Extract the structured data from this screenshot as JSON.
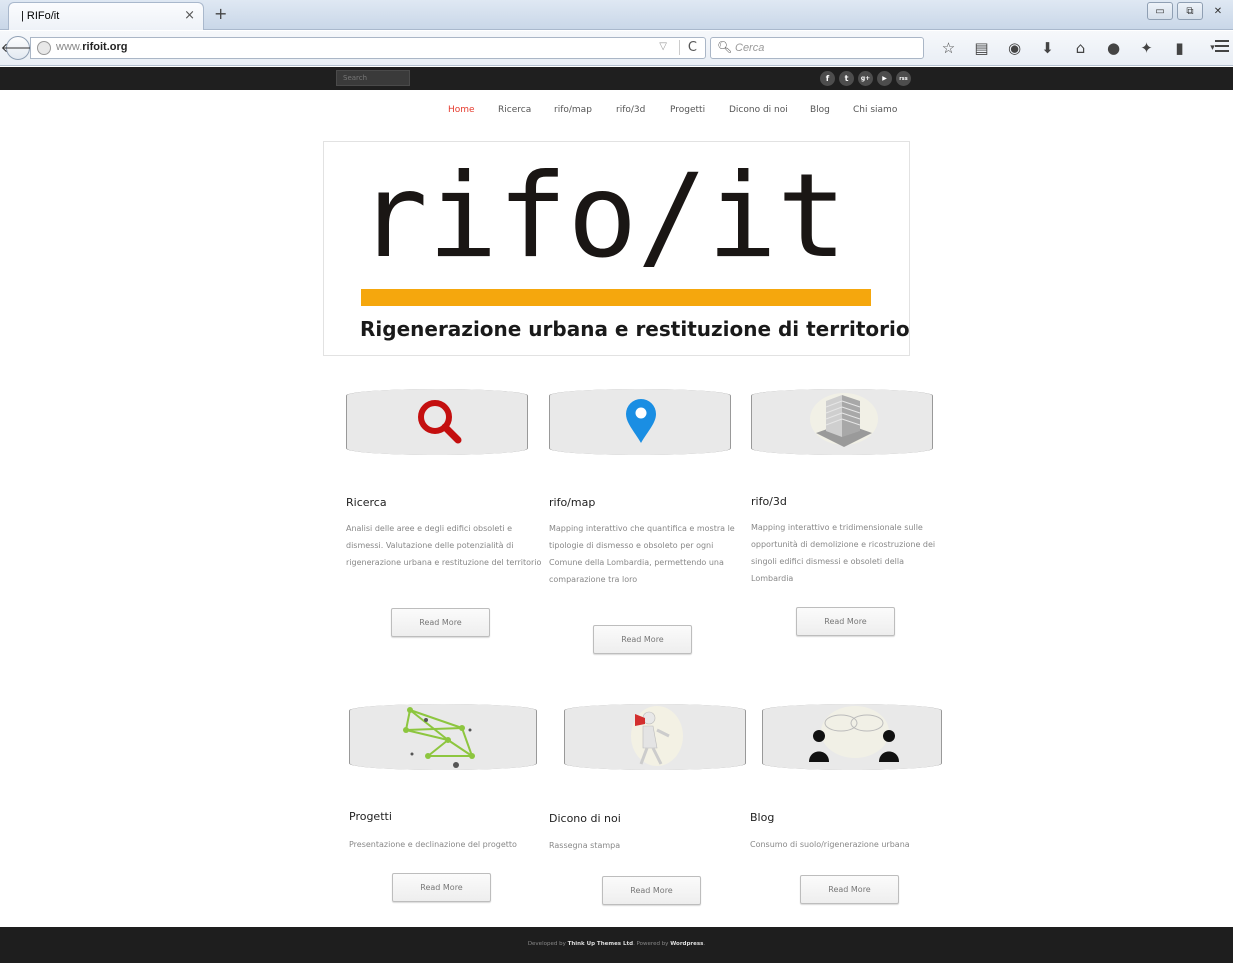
{
  "browser": {
    "tab_title": "| RIFo/it",
    "tab_close": "×",
    "new_tab": "+",
    "url_prefix": "www.",
    "url_domain": "rifoit.org",
    "search_placeholder": "Cerca",
    "toolbar_icons": [
      "star-icon",
      "reading-list-icon",
      "pocket-icon",
      "download-icon",
      "home-icon",
      "chat-icon",
      "extension-icon",
      "clipboard-icon",
      "dropdown-icon"
    ]
  },
  "site": {
    "search_placeholder": "Search",
    "social": [
      "f",
      "t",
      "g+",
      "▶",
      "rss"
    ],
    "nav": [
      {
        "label": "Home",
        "active": true
      },
      {
        "label": "Ricerca"
      },
      {
        "label": "rifo/map"
      },
      {
        "label": "rifo/3d"
      },
      {
        "label": "Progetti"
      },
      {
        "label": "Dicono di noi"
      },
      {
        "label": "Blog"
      },
      {
        "label": "Chi siamo"
      }
    ],
    "logo": {
      "title": "rifo/it",
      "subtitle": "Rigenerazione urbana e restituzione di territorio",
      "accent": "#f5a70d"
    },
    "cards": [
      {
        "title": "Ricerca",
        "desc": "Analisi delle aree e degli edifici obsoleti e dismessi. Valutazione delle potenzialità di rigenerazione urbana e restituzione del territorio",
        "button": "Read More",
        "icon": "magnifier-icon"
      },
      {
        "title": "rifo/map",
        "desc": "Mapping interattivo che quantifica e mostra le tipologie di dismesso e obsoleto per ogni Comune della Lombardia, permettendo una comparazione tra loro",
        "button": "Read More",
        "icon": "map-pin-icon"
      },
      {
        "title": "rifo/3d",
        "desc": "Mapping interattivo e tridimensionale sulle opportunità di demolizione e ricostruzione dei singoli edifici dismessi e obsoleti della Lombardia",
        "button": "Read More",
        "icon": "building-3d-icon"
      },
      {
        "title": "Progetti",
        "desc": "Presentazione e declinazione del progetto",
        "button": "Read More",
        "icon": "network-icon"
      },
      {
        "title": "Dicono di noi",
        "desc": "Rassegna stampa",
        "button": "Read More",
        "icon": "megaphone-icon"
      },
      {
        "title": "Blog",
        "desc": "Consumo di suolo/rigenerazione urbana",
        "button": "Read More",
        "icon": "conversation-icon"
      }
    ],
    "footer": {
      "developed_by": "Developed by",
      "theme_author": "Think Up Themes Ltd",
      "powered_by": ". Powered by",
      "platform": "Wordpress",
      "end": "."
    }
  }
}
